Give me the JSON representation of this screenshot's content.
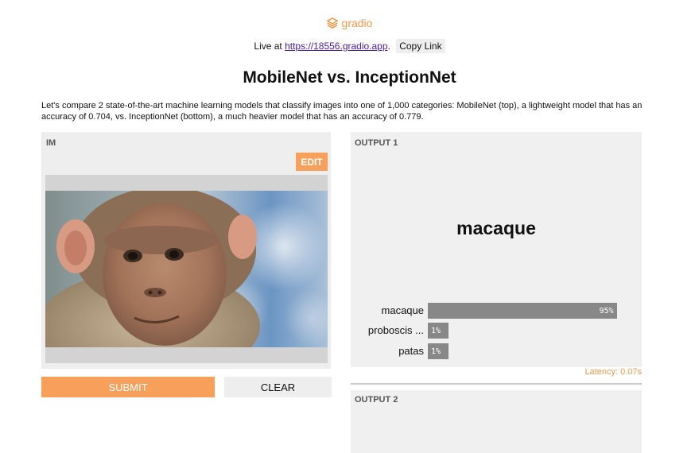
{
  "header": {
    "brand": "gradio",
    "live_prefix": "Live at ",
    "live_url": "https://18556.gradio.app",
    "live_suffix": ".",
    "copy_label": "Copy Link"
  },
  "title": "MobileNet vs. InceptionNet",
  "description": "Let's compare 2 state-of-the-art machine learning models that classify images into one of 1,000 categories: MobileNet (top), a lightweight model that has an accuracy of 0.704, vs. InceptionNet (bottom), a much heavier model that has an accuracy of 0.779.",
  "input": {
    "label": "IM",
    "edit_label": "EDIT",
    "submit_label": "SUBMIT",
    "clear_label": "CLEAR"
  },
  "output1": {
    "label": "OUTPUT 1",
    "top_label": "macaque",
    "confidences": [
      {
        "name": "macaque",
        "value": "95%",
        "fraction": 0.95
      },
      {
        "name": "proboscis ...",
        "value": "1%",
        "fraction": 0.01
      },
      {
        "name": "patas",
        "value": "1%",
        "fraction": 0.01
      }
    ],
    "latency": "Latency: 0.07s"
  },
  "output2": {
    "label": "OUTPUT 2"
  },
  "colors": {
    "accent": "#f6a05c",
    "bar": "#888888",
    "panel": "#f0f0f0"
  }
}
